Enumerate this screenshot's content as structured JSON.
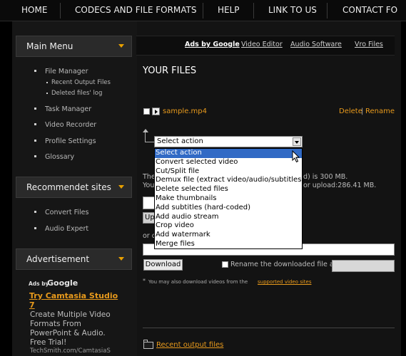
{
  "nav": {
    "items": [
      "HOME",
      "CODECS AND FILE FORMATS",
      "HELP",
      "LINK TO US",
      "CONTACT FO"
    ]
  },
  "sidebar": {
    "main_menu": {
      "title": "Main Menu",
      "items": [
        "File Manager",
        "Recent Output Files",
        "Deleted files' log",
        "Task Manager",
        "Video Recorder",
        "Profile Settings",
        "Glossary"
      ]
    },
    "recommended": {
      "title": "Recommendet sites",
      "items": [
        "Convert Files",
        "Audio Expert"
      ]
    },
    "advertisement": {
      "title": "Advertisement",
      "ads_by": "Ads by",
      "google": "Google",
      "headline_1": "Try Camtasia Studio",
      "headline_2": "7",
      "body_1": "Create Multiple Video",
      "body_2": "Formats From",
      "body_3": "PowerPoint & Audio.",
      "body_4": "Free Trial!",
      "url": "TechSmith.com/CamtasiaS"
    }
  },
  "adsbar": {
    "label": "Ads by Google",
    "links": [
      "Video Editor",
      "Audio Software",
      "Vro Files"
    ]
  },
  "main": {
    "title": "YOUR FILES",
    "file_name": "sample.mp4",
    "delete": "Delete",
    "sep": "|",
    "rename": "Rename",
    "select_value": "Select action",
    "dropdown_options": [
      "Select action",
      "Convert selected video",
      "Cut/Split file",
      "Demux file (extract video/audio/subtitles)",
      "Delete selected files",
      "Make thumbnails",
      "Add subtitles (hard-coded)",
      "Add audio stream",
      "Crop video",
      "Add watermark",
      "Merge files"
    ],
    "partial_1_left": "The",
    "partial_1_right": "d) is 300 MB.",
    "partial_2_left": "You",
    "partial_2_right": "or upload:286.41 MB.",
    "upload_partial": "Up",
    "or_partial": "or d",
    "download_label": "Download",
    "rename_label": "Rename the downloaded file as",
    "note_prefix": "You may also download videos from the",
    "note_link": "supported video sites",
    "recent_output": "Recent output files"
  },
  "colors": {
    "accent": "#e89a1c",
    "selection": "#316ac5"
  }
}
